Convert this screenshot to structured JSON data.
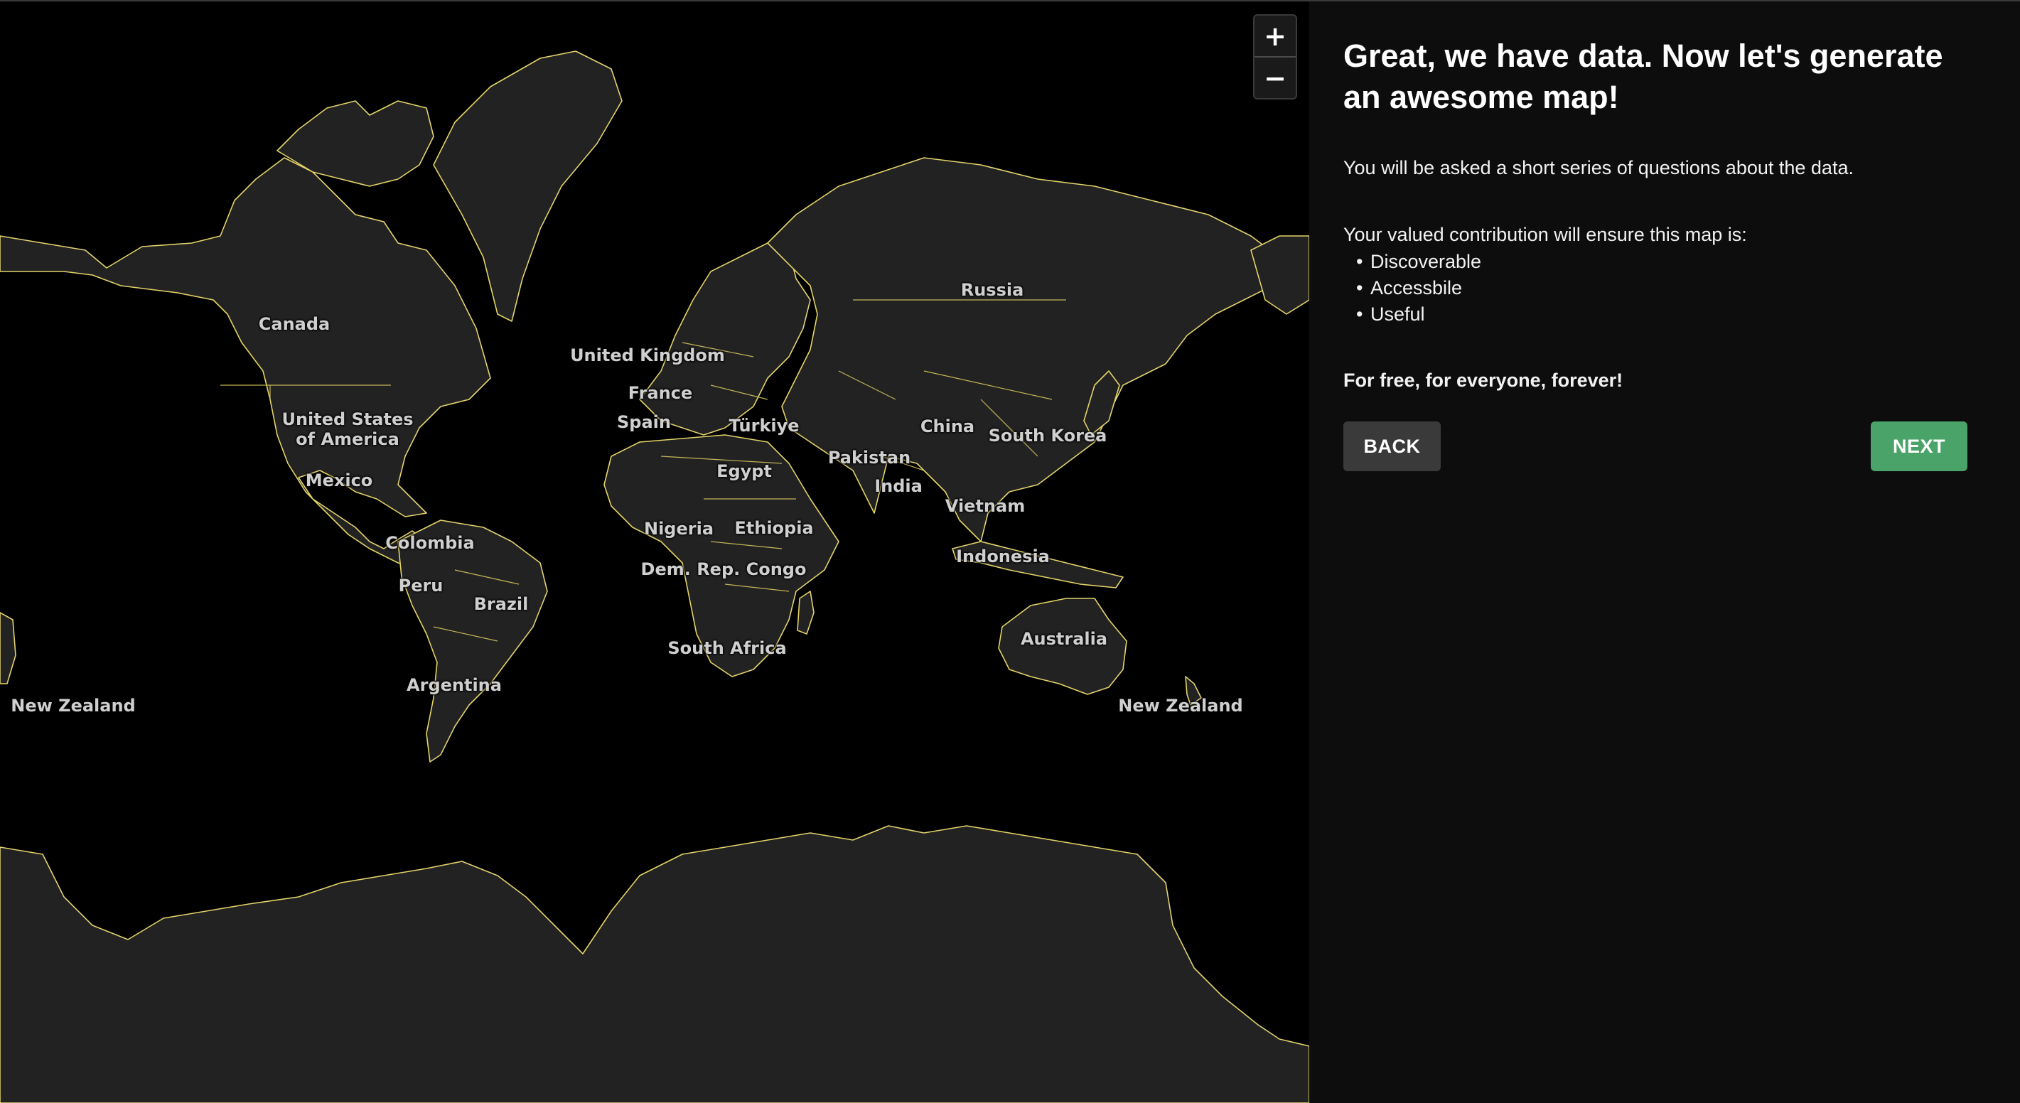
{
  "map": {
    "zoom_in_label": "+",
    "zoom_out_label": "−",
    "country_labels": [
      "Canada",
      "United States\nof America",
      "Mexico",
      "Colombia",
      "Peru",
      "Brazil",
      "Argentina",
      "New Zealand",
      "United Kingdom",
      "France",
      "Spain",
      "Türkiye",
      "Egypt",
      "Nigeria",
      "Ethiopia",
      "Dem. Rep. Congo",
      "South Africa",
      "Russia",
      "China",
      "South Korea",
      "Pakistan",
      "India",
      "Vietnam",
      "Indonesia",
      "Australia",
      "New Zealand"
    ]
  },
  "panel": {
    "title": "Great, we have data. Now let's generate an awesome map!",
    "intro": "You will be asked a short series of questions about the data.",
    "contribution_lead": "Your valued contribution will ensure this map is:",
    "qualities": [
      "Discoverable",
      "Accessbile",
      "Useful"
    ],
    "tagline": "For free, for everyone, forever!",
    "back_label": "BACK",
    "next_label": "NEXT"
  },
  "colors": {
    "map_background": "#000000",
    "land_fill": "#222222",
    "border_stroke": "#e3d36a",
    "panel_background": "#0d0d0d",
    "back_button": "#3a3a3a",
    "next_button": "#4aa469"
  }
}
